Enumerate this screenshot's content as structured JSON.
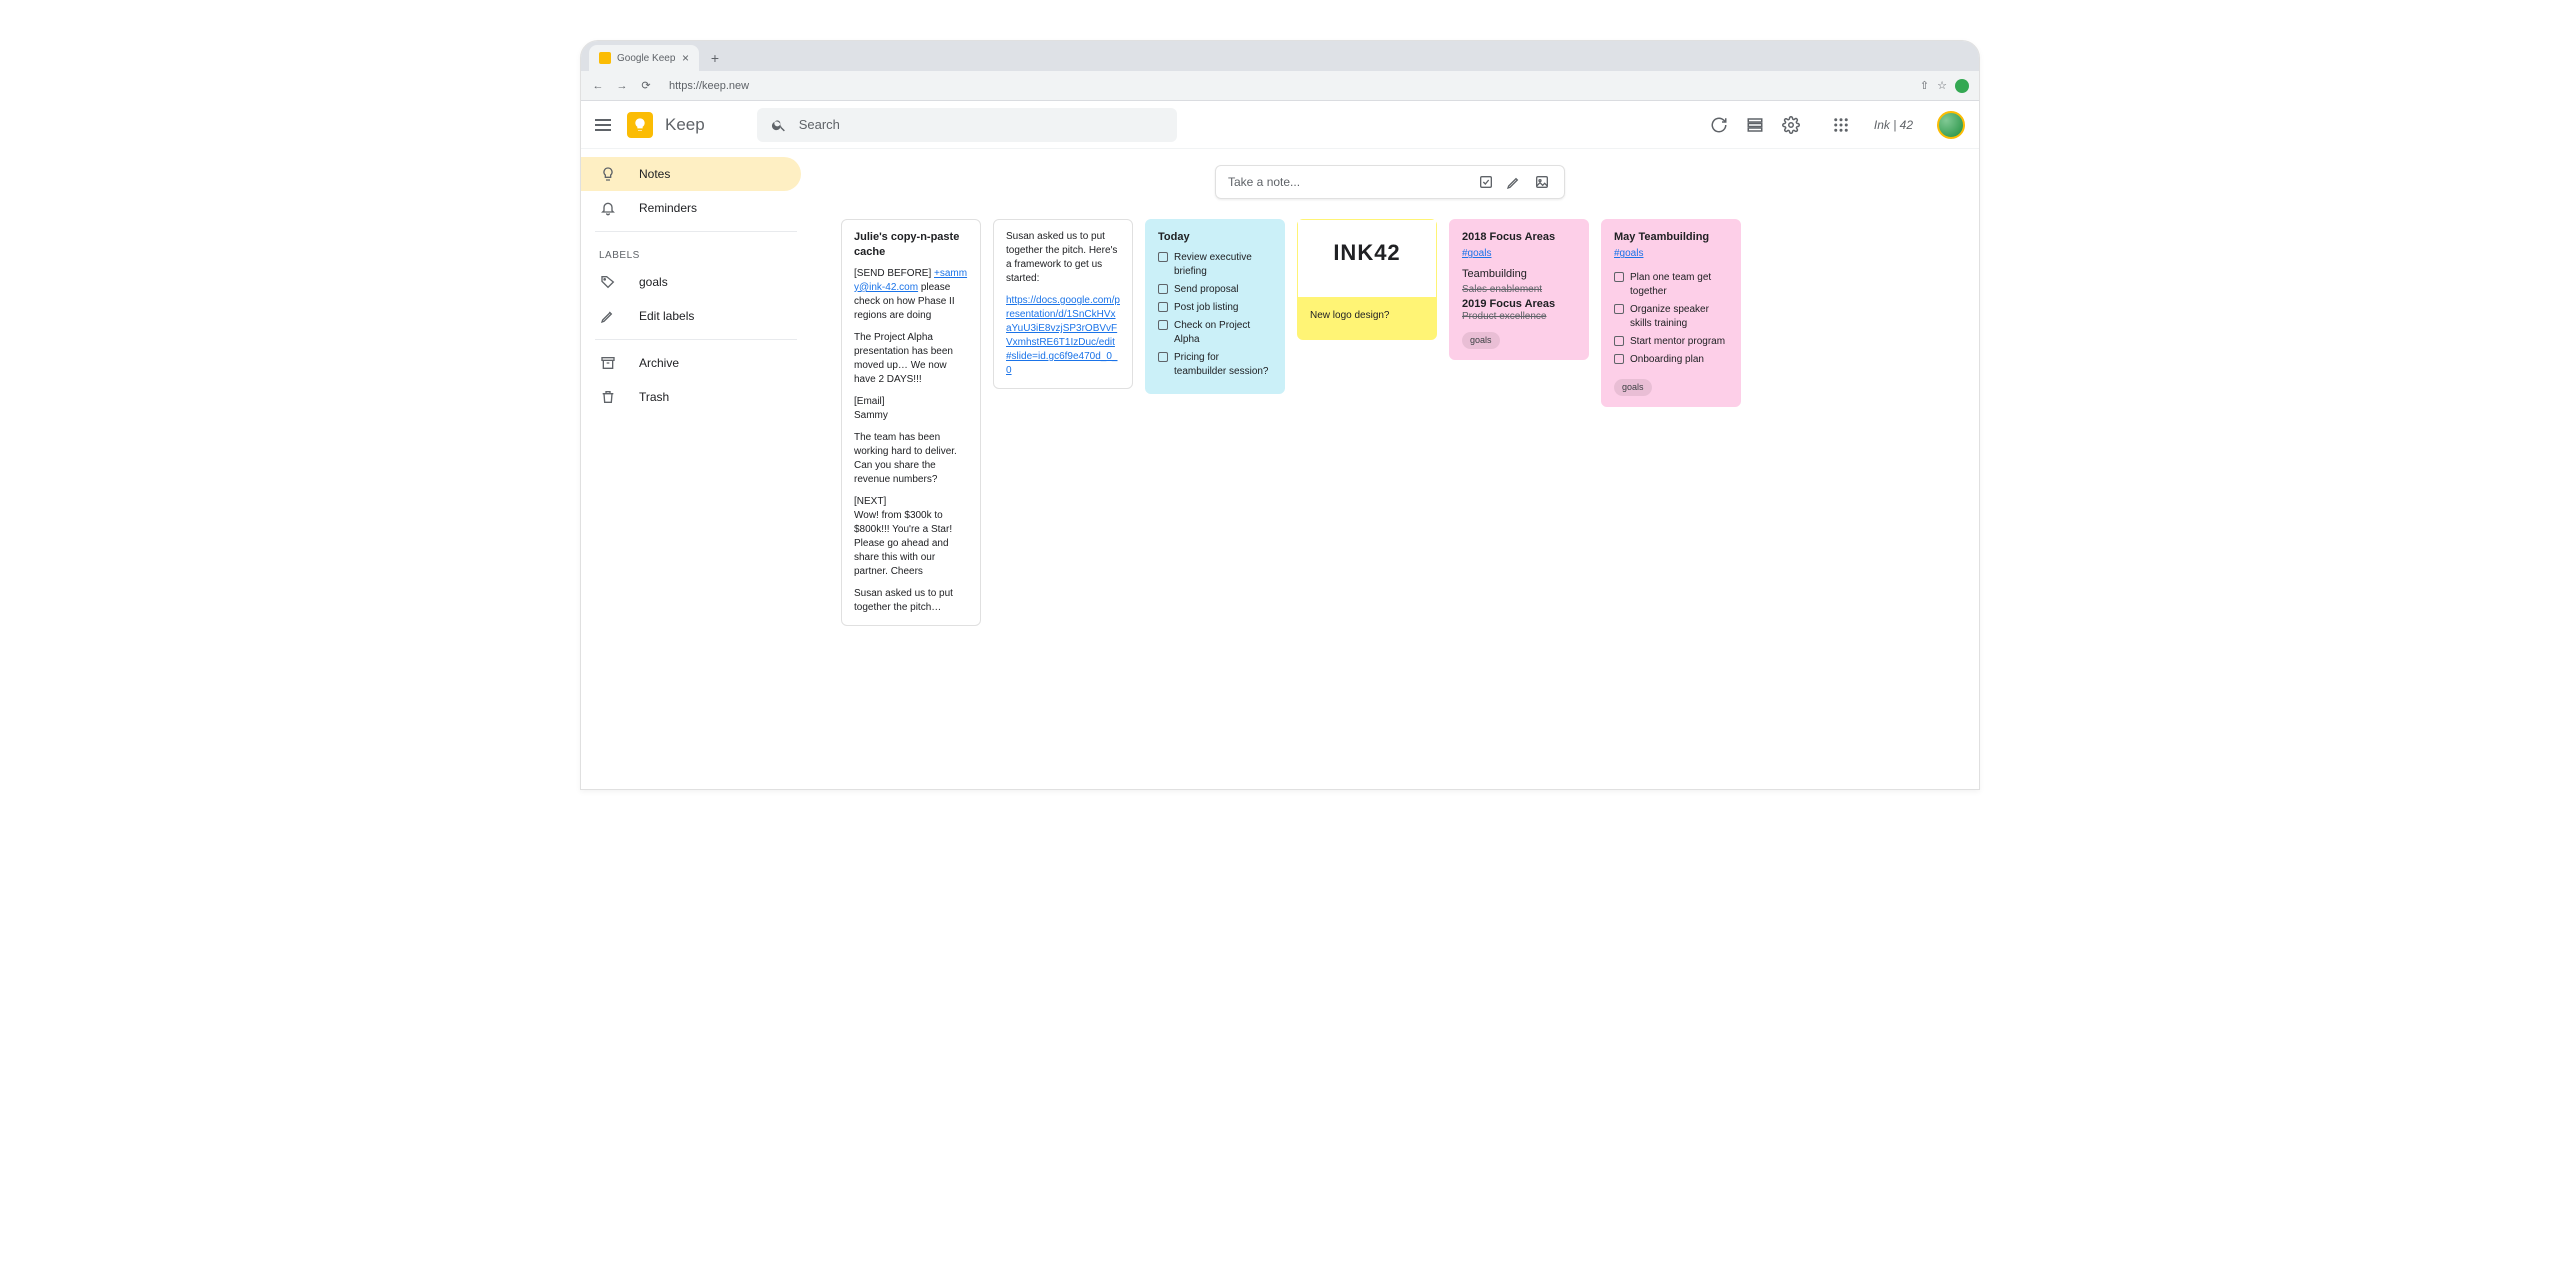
{
  "browser": {
    "tab_title": "Google Keep",
    "url": "https://keep.new"
  },
  "header": {
    "app_name": "Keep",
    "search_placeholder": "Search",
    "brand_badge": "Ink | 42"
  },
  "sidebar": {
    "items": [
      {
        "label": "Notes",
        "icon": "bulb"
      },
      {
        "label": "Reminders",
        "icon": "bell"
      }
    ],
    "labels_heading": "LABELS",
    "label_items": [
      {
        "label": "goals",
        "icon": "tag"
      },
      {
        "label": "Edit labels",
        "icon": "pencil"
      }
    ],
    "footer_items": [
      {
        "label": "Archive",
        "icon": "archive"
      },
      {
        "label": "Trash",
        "icon": "trash"
      }
    ]
  },
  "take_note": {
    "placeholder": "Take a note..."
  },
  "notes": [
    {
      "title": "Julie's copy-n-paste cache",
      "body_p1_prefix": "[SEND BEFORE] ",
      "body_p1_link": "+sammy@ink-42.com",
      "body_p1_suffix": " please check on how Phase II regions are doing",
      "body_p2": "The Project Alpha presentation has been moved up… We now have 2 DAYS!!!",
      "body_p3": "[Email]",
      "body_p3b": "Sammy",
      "body_p4": "The team has been working hard to deliver. Can you share the revenue numbers?",
      "body_p5": "[NEXT]",
      "body_p5b": "Wow! from $300k to $800k!!! You're a Star! Please go ahead and share this with our partner. Cheers",
      "body_p6": "Susan asked us to put together the pitch…"
    },
    {
      "body_intro": "Susan asked us to put together the pitch. Here's a framework to get us started:",
      "body_link": "https://docs.google.com/presentation/d/1SnCkHVxaYuU3iE8vzjSP3rOBVvFVxmhstRE6T1IzDuc/edit#slide=id.gc6f9e470d_0_0"
    },
    {
      "title": "Today",
      "checks": [
        "Review executive briefing",
        "Send proposal",
        "Post job listing",
        "Check on Project Alpha",
        "Pricing for teambuilder session?"
      ]
    },
    {
      "logo_text": "INK42",
      "question": "New logo design?"
    },
    {
      "title": "2018 Focus Areas",
      "hash": "#goals",
      "lines": [
        "Teambuilding",
        "Sales enablement"
      ],
      "title2": "2019 Focus Areas",
      "struck": "Product excellence",
      "chip": "goals"
    },
    {
      "title": "May Teambuilding",
      "hash": "#goals",
      "checks": [
        "Plan one team get together",
        "Organize speaker skills training",
        "Start mentor program",
        "Onboarding plan"
      ],
      "chip": "goals"
    }
  ]
}
